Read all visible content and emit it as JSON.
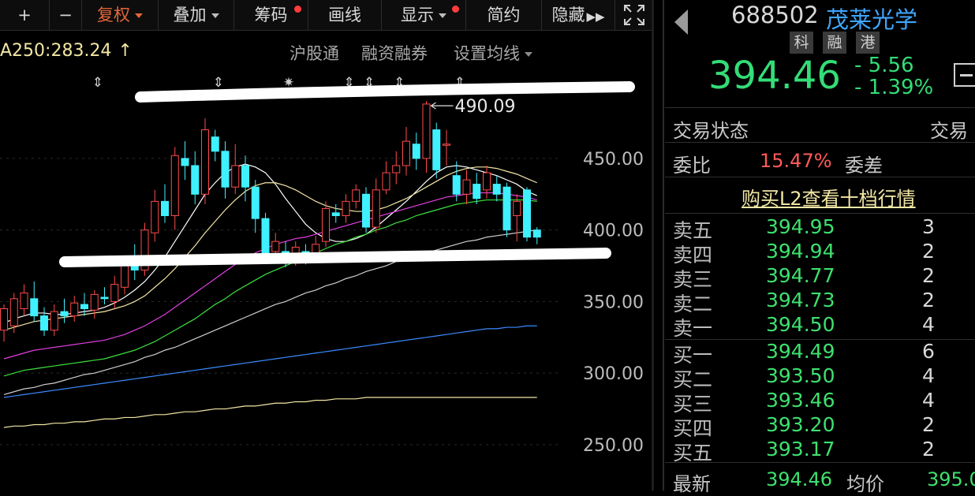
{
  "toolbar": {
    "zoom_in": "+",
    "zoom_out": "−",
    "fuquan": "复权",
    "diejia": "叠加",
    "chouma": "筹码",
    "huaxian": "画线",
    "xianshi": "显示",
    "jianyue": "简约",
    "yincang": "隐藏",
    "accent": "#e0663a"
  },
  "subbar": {
    "ma_label": "A250:283.24",
    "up_arrow": "↑",
    "hugutong": "沪股通",
    "rongzi": "融资融券",
    "shezhi": "设置均线"
  },
  "chart_data": {
    "type": "candlestick",
    "y_ticks": [
      "450.00",
      "400.00",
      "350.00",
      "300.00",
      "250.00"
    ],
    "y_tick_values": [
      450,
      400,
      350,
      300,
      250
    ],
    "ylim": [
      218,
      510
    ],
    "high_marker": "490.09",
    "high_value": 490.09,
    "candles": [
      [
        330,
        345,
        322,
        348
      ],
      [
        333,
        352,
        328,
        356
      ],
      [
        345,
        356,
        340,
        362
      ],
      [
        352,
        340,
        336,
        364
      ],
      [
        340,
        330,
        326,
        346
      ],
      [
        330,
        343,
        326,
        348
      ],
      [
        343,
        340,
        335,
        352
      ],
      [
        340,
        349,
        336,
        354
      ],
      [
        348,
        345,
        340,
        356
      ],
      [
        344,
        355,
        338,
        358
      ],
      [
        353,
        352,
        348,
        360
      ],
      [
        350,
        362,
        345,
        368
      ],
      [
        360,
        378,
        355,
        382
      ],
      [
        375,
        372,
        365,
        390
      ],
      [
        372,
        400,
        368,
        405
      ],
      [
        398,
        420,
        392,
        428
      ],
      [
        420,
        410,
        405,
        432
      ],
      [
        410,
        452,
        400,
        458
      ],
      [
        450,
        445,
        435,
        462
      ],
      [
        445,
        425,
        418,
        455
      ],
      [
        425,
        470,
        418,
        478
      ],
      [
        465,
        455,
        448,
        470
      ],
      [
        455,
        430,
        422,
        462
      ],
      [
        430,
        445,
        425,
        460
      ],
      [
        445,
        430,
        420,
        452
      ],
      [
        430,
        408,
        398,
        435
      ],
      [
        408,
        380,
        378,
        412
      ],
      [
        385,
        392,
        378,
        398
      ],
      [
        385,
        378,
        374,
        392
      ],
      [
        380,
        388,
        375,
        392
      ],
      [
        385,
        380,
        376,
        390
      ],
      [
        382,
        390,
        378,
        396
      ],
      [
        392,
        415,
        388,
        420
      ],
      [
        412,
        410,
        405,
        418
      ],
      [
        410,
        420,
        405,
        425
      ],
      [
        420,
        428,
        415,
        432
      ],
      [
        425,
        402,
        398,
        430
      ],
      [
        402,
        428,
        398,
        436
      ],
      [
        428,
        440,
        425,
        448
      ],
      [
        440,
        445,
        432,
        455
      ],
      [
        445,
        462,
        438,
        472
      ],
      [
        460,
        450,
        442,
        468
      ],
      [
        450,
        488,
        440,
        490
      ],
      [
        470,
        442,
        436,
        475
      ],
      [
        460,
        460,
        445,
        470
      ],
      [
        438,
        425,
        420,
        448
      ],
      [
        425,
        435,
        418,
        442
      ],
      [
        432,
        422,
        418,
        440
      ],
      [
        428,
        440,
        422,
        445
      ],
      [
        432,
        425,
        420,
        438
      ],
      [
        430,
        400,
        395,
        433
      ],
      [
        410,
        420,
        392,
        425
      ],
      [
        428,
        395,
        392,
        430
      ],
      [
        400,
        395,
        390,
        402
      ]
    ],
    "ma_lines": [
      {
        "color": "#ffffff",
        "values": [
          335,
          338,
          340,
          342,
          342,
          341,
          341,
          342,
          343,
          344,
          346,
          349,
          353,
          358,
          364,
          372,
          381,
          392,
          403,
          414,
          425,
          433,
          440,
          444,
          446,
          444,
          440,
          432,
          422,
          413,
          404,
          398,
          394,
          392,
          392,
          394,
          397,
          402,
          408,
          414,
          420,
          427,
          434,
          440,
          444,
          445,
          444,
          442,
          440,
          438,
          435,
          432,
          427,
          424
        ]
      },
      {
        "color": "#f2e7a4",
        "values": [
          330,
          332,
          334,
          336,
          337,
          338,
          339,
          340,
          341,
          342,
          343,
          345,
          347,
          350,
          354,
          360,
          366,
          373,
          381,
          389,
          398,
          406,
          414,
          421,
          427,
          431,
          433,
          433,
          431,
          428,
          424,
          420,
          417,
          415,
          414,
          413,
          413,
          414,
          416,
          419,
          422,
          426,
          430,
          434,
          438,
          441,
          443,
          444,
          444,
          443,
          441,
          439,
          436,
          433
        ]
      },
      {
        "color": "#e23fe2",
        "values": [
          310,
          312,
          314,
          316,
          317,
          318,
          319,
          320,
          321,
          322,
          323,
          325,
          327,
          330,
          333,
          337,
          341,
          346,
          351,
          356,
          361,
          366,
          371,
          376,
          380,
          384,
          387,
          390,
          392,
          394,
          395,
          397,
          399,
          401,
          403,
          405,
          407,
          409,
          411,
          413,
          415,
          417,
          419,
          421,
          423,
          424,
          425,
          426,
          426,
          426,
          425,
          424,
          423,
          421
        ]
      },
      {
        "color": "#3ce03c",
        "values": [
          298,
          300,
          302,
          303,
          304,
          305,
          306,
          307,
          308,
          309,
          310,
          312,
          314,
          316,
          319,
          322,
          326,
          330,
          334,
          338,
          343,
          348,
          352,
          357,
          361,
          365,
          369,
          372,
          375,
          378,
          381,
          384,
          387,
          390,
          392,
          395,
          397,
          400,
          402,
          405,
          407,
          410,
          412,
          414,
          416,
          418,
          419,
          420,
          421,
          421,
          421,
          421,
          421,
          420
        ]
      },
      {
        "color": "#cfcfcf",
        "values": [
          285,
          287,
          289,
          290,
          292,
          293,
          295,
          297,
          299,
          300,
          302,
          304,
          306,
          308,
          311,
          313,
          316,
          318,
          321,
          324,
          327,
          330,
          333,
          336,
          339,
          342,
          345,
          348,
          350,
          353,
          356,
          358,
          361,
          363,
          366,
          368,
          371,
          373,
          375,
          378,
          380,
          382,
          384,
          386,
          388,
          390,
          392,
          393,
          395,
          396,
          397,
          398,
          399,
          400
        ]
      },
      {
        "color": "#3a8cff",
        "values": [
          283,
          284,
          285,
          286,
          287,
          288,
          289,
          290,
          291,
          292,
          293,
          294,
          295,
          296,
          297,
          298,
          299,
          300,
          301,
          302,
          303,
          304,
          305,
          306,
          307,
          308,
          309,
          310,
          311,
          312,
          313,
          314,
          315,
          316,
          317,
          318,
          319,
          320,
          321,
          322,
          323,
          324,
          325,
          326,
          327,
          328,
          329,
          330,
          331,
          331,
          332,
          332,
          333,
          333
        ]
      },
      {
        "color": "#f2e7a4",
        "values": [
          262,
          263,
          263,
          264,
          264,
          265,
          265,
          266,
          266,
          267,
          268,
          268,
          269,
          269,
          270,
          271,
          271,
          272,
          273,
          273,
          274,
          275,
          275,
          276,
          277,
          277,
          278,
          279,
          279,
          280,
          280,
          281,
          281,
          282,
          282,
          282,
          283,
          283,
          283,
          283,
          283,
          283,
          283,
          283,
          283,
          283,
          283,
          283,
          283,
          283,
          283,
          283,
          283,
          283
        ]
      }
    ],
    "event_marks": [
      {
        "candle": 9,
        "glyph": "⇕"
      },
      {
        "candle": 21,
        "glyph": "⇕"
      },
      {
        "candle": 28,
        "glyph": "✷"
      },
      {
        "candle": 34,
        "glyph": "⇕"
      },
      {
        "candle": 36,
        "glyph": "⇕"
      },
      {
        "candle": 39,
        "glyph": "⇕"
      },
      {
        "candle": 45,
        "glyph": "⇕"
      }
    ],
    "annotation_lines": [
      [
        480,
        478
      ],
      [
        388,
        385
      ]
    ],
    "up_color": "#ff4a4a",
    "down_color": "#3ff0ff"
  },
  "panel": {
    "code": "688502",
    "name": "茂莱光学",
    "tags": [
      "科",
      "融",
      "港"
    ],
    "price": "394.46",
    "change": "- 5.56",
    "change_pct": "- 1.39%",
    "trade_status_label": "交易状态",
    "trade_status_value": "交易",
    "weibi_label": "委比",
    "weibi_value": "15.47%",
    "weicha_label": "委差",
    "l2_link": "购买L2查看十档行情",
    "orderbook": [
      {
        "side": "卖五",
        "price": "394.95",
        "vol": "3"
      },
      {
        "side": "卖四",
        "price": "394.94",
        "vol": "2"
      },
      {
        "side": "卖三",
        "price": "394.77",
        "vol": "2"
      },
      {
        "side": "卖二",
        "price": "394.73",
        "vol": "2"
      },
      {
        "side": "卖一",
        "price": "394.50",
        "vol": "4"
      },
      {
        "side": "买一",
        "price": "394.49",
        "vol": "6"
      },
      {
        "side": "买二",
        "price": "393.50",
        "vol": "4"
      },
      {
        "side": "买三",
        "price": "393.46",
        "vol": "4"
      },
      {
        "side": "买四",
        "price": "393.20",
        "vol": "2"
      },
      {
        "side": "买五",
        "price": "393.17",
        "vol": "2"
      }
    ],
    "latest_label": "最新",
    "latest_value": "394.46",
    "avg_label": "均价",
    "avg_value": "395.0",
    "red": "#ff4a4a",
    "green": "#33dd77"
  }
}
